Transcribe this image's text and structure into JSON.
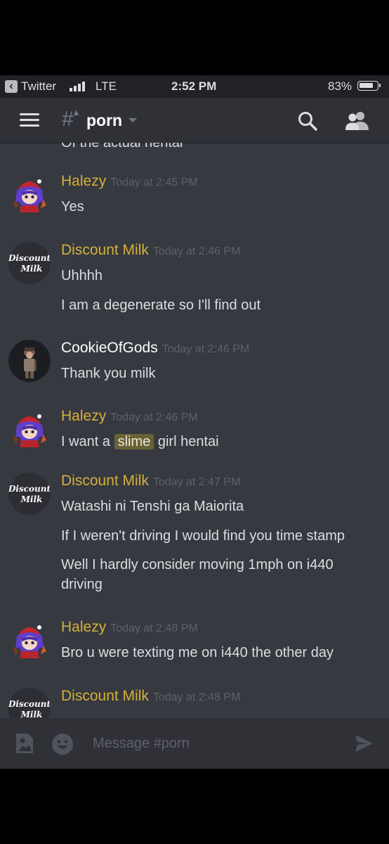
{
  "status_bar": {
    "back_app": "Twitter",
    "network": "LTE",
    "time": "2:52 PM",
    "battery_percent": "83%",
    "battery_level": 0.83
  },
  "header": {
    "channel_name": "porn",
    "channel_icon": "hashtag-alert-icon",
    "icons": [
      "menu-icon",
      "search-icon",
      "members-icon"
    ]
  },
  "messages": {
    "partial_top_text": "Of the actual hentai",
    "groups": [
      {
        "author": "Halezy",
        "author_color": "#d4b03a",
        "timestamp": "Today at 2:45 PM",
        "lines": [
          "Yes"
        ]
      },
      {
        "author": "Discount Milk",
        "author_color": "#d4b03a",
        "timestamp": "Today at 2:46 PM",
        "lines": [
          "Uhhhh",
          "I am a degenerate so I'll find out"
        ]
      },
      {
        "author": "CookieOfGods",
        "author_color": "#ffffff",
        "timestamp": "Today at 2:46 PM",
        "lines": [
          "Thank you milk"
        ]
      },
      {
        "author": "Halezy",
        "author_color": "#d4b03a",
        "timestamp": "Today at 2:46 PM",
        "line_before": "I want a",
        "highlight": "slime",
        "line_after": "girl hentai"
      },
      {
        "author": "Discount Milk",
        "author_color": "#d4b03a",
        "timestamp": "Today at 2:47 PM",
        "lines": [
          "Watashi ni Tenshi ga Maiorita",
          "If I weren't driving I would find you time stamp",
          "Well I hardly consider moving 1mph on i440 driving"
        ]
      },
      {
        "author": "Halezy",
        "author_color": "#d4b03a",
        "timestamp": "Today at 2:48 PM",
        "lines": [
          "Bro u were texting me on i440 the other day"
        ]
      },
      {
        "author": "Discount Milk",
        "author_color": "#d4b03a",
        "timestamp": "Today at 2:48 PM",
        "lines": []
      }
    ],
    "avatar_logo_text": [
      "Discount",
      "Milk"
    ]
  },
  "composer": {
    "placeholder": "Message #porn",
    "icons": [
      "image-attach-icon",
      "emoji-icon",
      "send-icon"
    ]
  },
  "colors": {
    "background": "#36393f",
    "header_bg": "#2f3136",
    "status_bg": "#202225",
    "text": "#dcddde",
    "muted": "#72767d",
    "accent_name": "#d4b03a",
    "highlight_bg": "#6a6237"
  }
}
